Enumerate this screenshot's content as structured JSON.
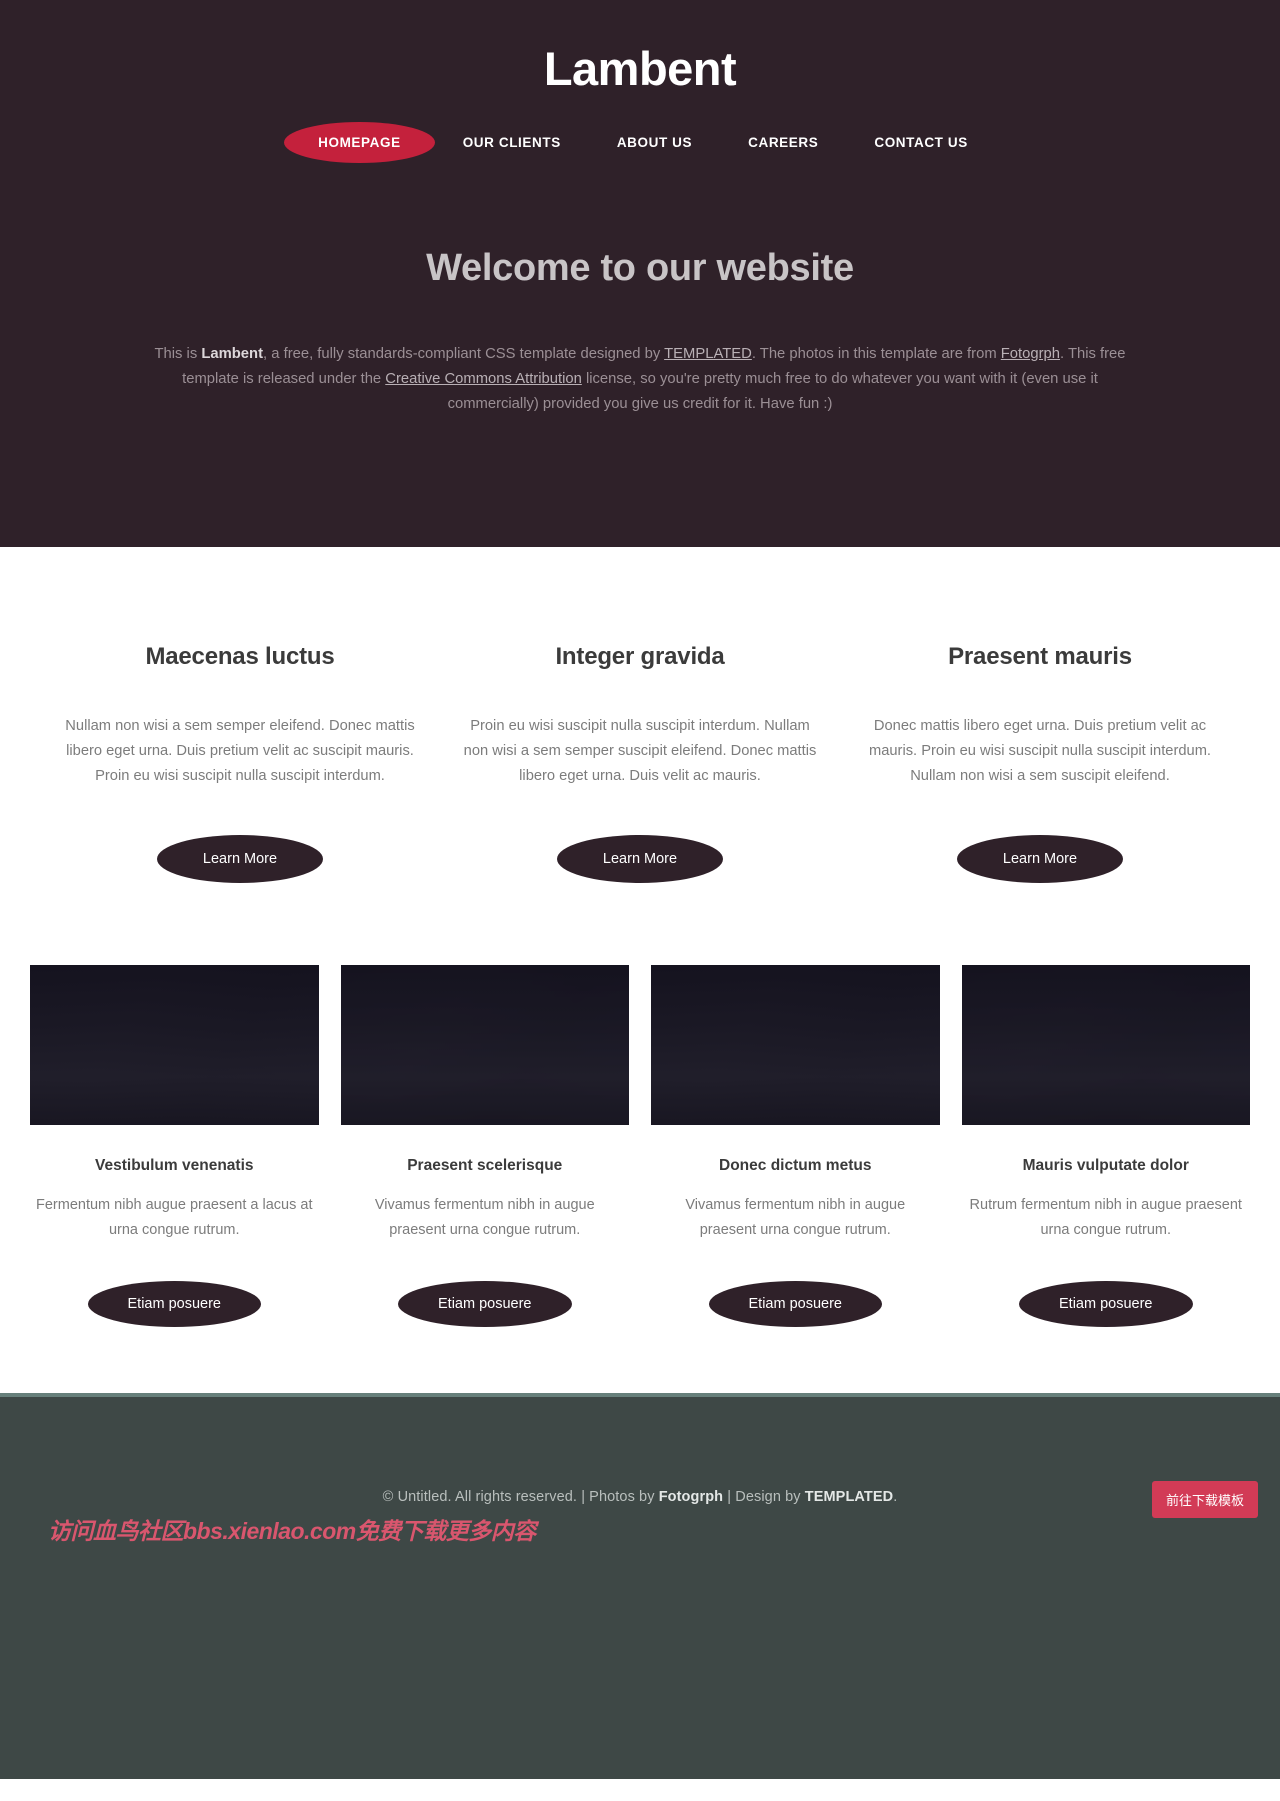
{
  "header": {
    "site_title": "Lambent",
    "nav": [
      {
        "label": "HOMEPAGE",
        "active": true
      },
      {
        "label": "OUR CLIENTS",
        "active": false
      },
      {
        "label": "ABOUT US",
        "active": false
      },
      {
        "label": "CAREERS",
        "active": false
      },
      {
        "label": "CONTACT US",
        "active": false
      }
    ],
    "welcome_heading": "Welcome to our website",
    "intro": {
      "part1": "This is ",
      "brand": "Lambent",
      "part2": ", a free, fully standards-compliant CSS template designed by ",
      "link_templated": "TEMPLATED",
      "part3": ". The photos in this template are from ",
      "link_fotogrph": "Fotogrph",
      "part4": ". This free template is released under the ",
      "link_cc": "Creative Commons Attribution",
      "part5": " license, so you're pretty much free to do whatever you want with it (even use it commercially) provided you give us credit for it. Have fun :)"
    }
  },
  "features": [
    {
      "title": "Maecenas luctus",
      "text": "Nullam non wisi a sem semper eleifend. Donec mattis libero eget urna. Duis pretium velit ac suscipit mauris. Proin eu wisi suscipit nulla suscipit interdum.",
      "button": "Learn More"
    },
    {
      "title": "Integer gravida",
      "text": "Proin eu wisi suscipit nulla suscipit interdum. Nullam non wisi a sem semper suscipit eleifend. Donec mattis libero eget urna. Duis velit ac mauris.",
      "button": "Learn More"
    },
    {
      "title": "Praesent mauris",
      "text": "Donec mattis libero eget urna. Duis pretium velit ac mauris. Proin eu wisi suscipit nulla suscipit interdum. Nullam non wisi a sem suscipit eleifend.",
      "button": "Learn More"
    }
  ],
  "gallery": [
    {
      "title": "Vestibulum venenatis",
      "text": "Fermentum nibh augue praesent a lacus at urna congue rutrum.",
      "button": "Etiam posuere"
    },
    {
      "title": "Praesent scelerisque",
      "text": "Vivamus fermentum nibh in augue praesent urna congue rutrum.",
      "button": "Etiam posuere"
    },
    {
      "title": "Donec dictum metus",
      "text": "Vivamus fermentum nibh in augue praesent urna congue rutrum.",
      "button": "Etiam posuere"
    },
    {
      "title": "Mauris vulputate dolor",
      "text": "Rutrum fermentum nibh in augue praesent urna congue rutrum.",
      "button": "Etiam posuere"
    }
  ],
  "footer": {
    "copy_part1": "© Untitled. All rights reserved. | Photos by ",
    "copy_brand1": "Fotogrph",
    "copy_part2": " | Design by ",
    "copy_brand2": "TEMPLATED",
    "copy_part3": ".",
    "download_badge": "前往下载模板",
    "watermark": "访问血鸟社区bbs.xienlao.com免费下载更多内容"
  },
  "colors": {
    "header_bg": "#2f2129",
    "accent_red": "#c4213c",
    "footer_bg": "#3e4846",
    "footer_rule": "#67807b",
    "badge_red": "#d23b56",
    "watermark_red": "#d9566e"
  }
}
